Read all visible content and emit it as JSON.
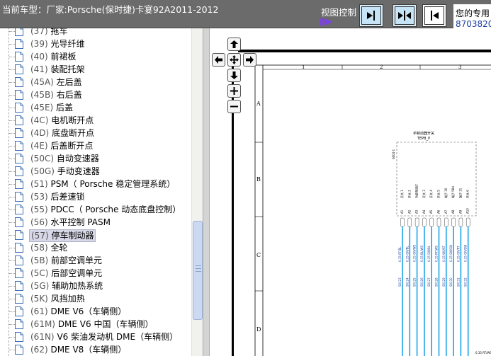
{
  "header": {
    "title": "当前车型：厂家:Porsche(保时捷)卡宴92A2011-2012",
    "view_control_label": "视图控制",
    "right_line1": "您的专用",
    "right_line2": "8703820"
  },
  "tree": {
    "items": [
      {
        "code": "(37)",
        "name": "拖车"
      },
      {
        "code": "(39)",
        "name": "光导纤维"
      },
      {
        "code": "(40)",
        "name": "前裙板"
      },
      {
        "code": "(41)",
        "name": "装配托架"
      },
      {
        "code": "(45A)",
        "name": "左后盖"
      },
      {
        "code": "(45B)",
        "name": "右后盖"
      },
      {
        "code": "(45E)",
        "name": "后盖"
      },
      {
        "code": "(4C)",
        "name": "电机断开点"
      },
      {
        "code": "(4D)",
        "name": "底盘断开点"
      },
      {
        "code": "(4E)",
        "name": "后盖断开点"
      },
      {
        "code": "(50C)",
        "name": "自动变速器"
      },
      {
        "code": "(50G)",
        "name": "手动变速器"
      },
      {
        "code": "(51)",
        "name": "PSM（ Porsche 稳定管理系统）"
      },
      {
        "code": "(53)",
        "name": "后差速锁"
      },
      {
        "code": "(55)",
        "name": "PDCC（ Porsche 动态底盘控制）"
      },
      {
        "code": "(56)",
        "name": "水平控制  PASM"
      },
      {
        "code": "(57)",
        "name": "停车制动器",
        "selected": true
      },
      {
        "code": "(58)",
        "name": "全轮"
      },
      {
        "code": "(5B)",
        "name": "前部空调单元"
      },
      {
        "code": "(5C)",
        "name": "后部空调单元"
      },
      {
        "code": "(5G)",
        "name": "辅助加热系统"
      },
      {
        "code": "(5K)",
        "name": "风挡加热"
      },
      {
        "code": "(61)",
        "name": "DME V6（车辆侧）"
      },
      {
        "code": "(61M)",
        "name": "DME V6 中国（车辆侧）"
      },
      {
        "code": "(61N)",
        "name": "V6 柴油发动机  DME（车辆侧）"
      },
      {
        "code": "(62)",
        "name": "DME V8（车辆侧）"
      }
    ]
  },
  "diagram": {
    "columns": [
      "1",
      "2",
      "3"
    ],
    "rows": [
      "A",
      "B",
      "C",
      "D"
    ],
    "component_title": "手制动器开关",
    "component_code": "TEPB_P",
    "component_ref": "S604-1",
    "pins": [
      "A1",
      "A2",
      "A3",
      "A4",
      "A5",
      "A6",
      "A7",
      "A8",
      "A9",
      "A10"
    ],
    "pin_labels": [
      "开关 1",
      "开关 2",
      "功能电流灯",
      "开关 3",
      "开关 4",
      "开关 5",
      "端子 30",
      "端子 58d",
      "端子 31",
      "开关 6"
    ],
    "wire_codes": [
      "0.35 RT/BL",
      "0.35 GN/BL",
      "0.35 GN/WS",
      "0.35 BL/WS",
      "0.35 SW/BL",
      "0.35 RT/WS",
      "0.35 WS/RT",
      "0.35 SW/GN",
      "0.35 GN/RT",
      "0.35 GN/SW"
    ],
    "wire_numbers": [
      "S0123",
      "S0124",
      "S0125",
      "S0126",
      "S0127",
      "S0128",
      "S0129",
      "S0130",
      "S0131",
      "S0132"
    ],
    "footer_code": "0.35 RT/WS"
  },
  "colors": {
    "header_bg": "#6b6b6b",
    "wire": "#1aa3e6",
    "selected_bg": "#d7d7e8"
  },
  "icons": {
    "nav_up": "arrow-up-icon",
    "nav_left": "arrow-left-icon",
    "nav_center": "pan-center-icon",
    "nav_right": "arrow-right-icon",
    "nav_down": "arrow-down-icon",
    "zoom_in": "plus-icon",
    "zoom_out": "minus-icon"
  }
}
